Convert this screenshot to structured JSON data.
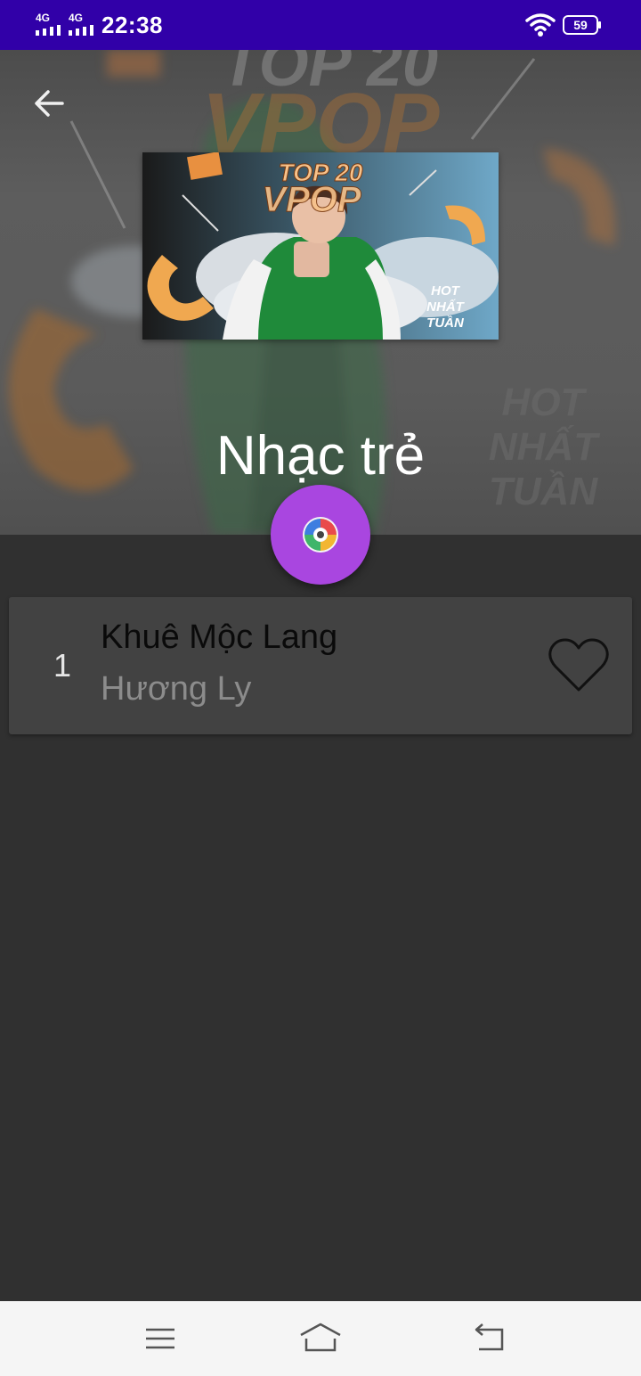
{
  "status_bar": {
    "signal1": "4G",
    "signal2": "4G",
    "time": "22:38",
    "battery": "59",
    "wifi_icon": "wifi-icon"
  },
  "header": {
    "back_icon": "arrow-left-icon",
    "title": "Nhạc trẻ",
    "cover": {
      "line1": "TOP 20",
      "line2": "VPOP",
      "badge1": "HOT",
      "badge2": "NHẤT",
      "badge3": "TUẦN"
    }
  },
  "fab": {
    "icon": "disc-icon",
    "color": "#a946e0"
  },
  "songs": [
    {
      "index": "1",
      "title": "Khuê Mộc Lang",
      "artist": "Hương Ly",
      "favorite_icon": "heart-outline-icon"
    }
  ],
  "colors": {
    "status_bar": "#3100a8",
    "background": "#303030",
    "card": "#424242",
    "nav_bar": "#f5f5f5"
  },
  "nav": {
    "icons": [
      "menu-icon",
      "home-icon",
      "back-icon"
    ]
  }
}
